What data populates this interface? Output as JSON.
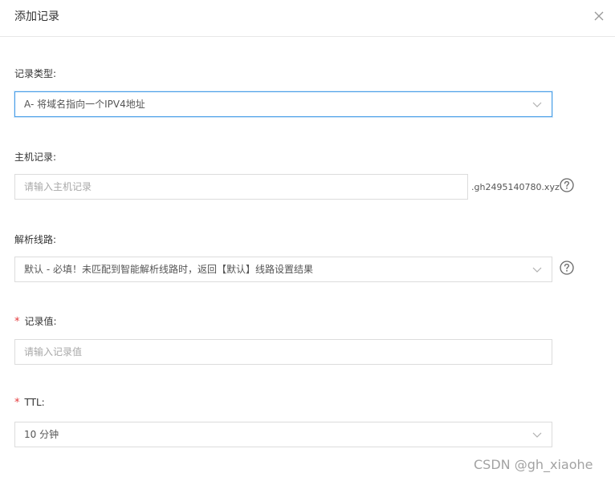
{
  "dialog": {
    "title": "添加记录",
    "close_icon": "close-icon"
  },
  "record_type": {
    "label": "记录类型:",
    "value": "A- 将域名指向一个IPV4地址"
  },
  "host_record": {
    "label": "主机记录:",
    "placeholder": "请输入主机记录",
    "suffix": ".gh2495140780.xyz"
  },
  "resolve_line": {
    "label": "解析线路:",
    "value": "默认 - 必填！未匹配到智能解析线路时，返回【默认】线路设置结果"
  },
  "record_value": {
    "required_mark": "*",
    "label": "记录值:",
    "placeholder": "请输入记录值"
  },
  "ttl": {
    "required_mark": "*",
    "label": "TTL:",
    "value": "10 分钟"
  },
  "watermark": "CSDN @gh_xiaohe",
  "colors": {
    "focus_border": "#4a9fe8",
    "required": "#e4393c",
    "border": "#dcdcdc"
  }
}
